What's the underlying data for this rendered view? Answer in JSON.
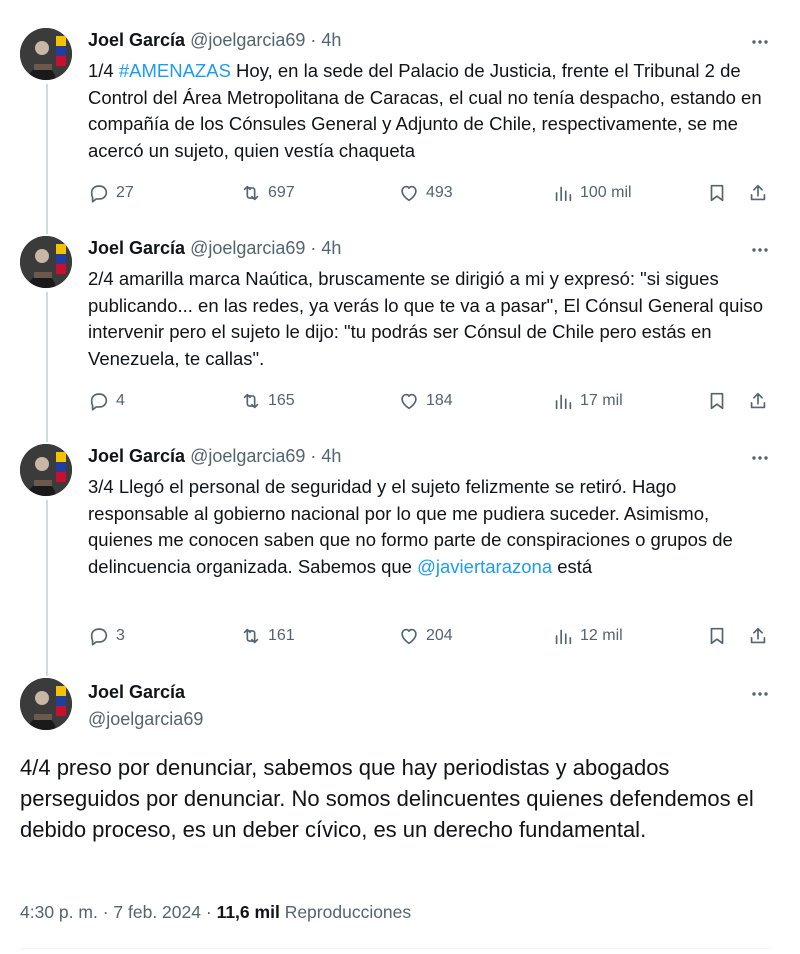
{
  "author": {
    "name": "Joel García",
    "handle": "@joelgarcia69"
  },
  "replies": [
    {
      "time": "4h",
      "number": "1/4",
      "hashtag": "#AMENAZAS",
      "text_after_hashtag": " Hoy, en la sede del Palacio de Justicia, frente el Tribunal 2 de Control del Área Metropolitana de Caracas, el cual no tenía despacho, estando en compañía de los Cónsules General y Adjunto de Chile, respectivamente, se me acercó un sujeto, quien vestía chaqueta",
      "stats": {
        "replies": "27",
        "reposts": "697",
        "likes": "493",
        "views": "100 mil"
      }
    },
    {
      "time": "4h",
      "text": "2/4 amarilla marca Naútica, bruscamente se dirigió a mi y expresó: \"si sigues publicando... en las redes, ya verás lo que te va a pasar\", El Cónsul General quiso intervenir pero el sujeto le dijo: \"tu podrás ser Cónsul de Chile pero estás en Venezuela, te callas\".",
      "stats": {
        "replies": "4",
        "reposts": "165",
        "likes": "184",
        "views": "17 mil"
      }
    },
    {
      "time": "4h",
      "text_before_mention": "3/4 Llegó el personal de seguridad y el sujeto felizmente se retiró. Hago responsable al gobierno nacional por lo que me pudiera suceder. Asimismo, quienes me conocen saben que no formo parte de conspiraciones o grupos de delincuencia organizada. Sabemos que ",
      "mention": "@javiertarazona",
      "text_after_mention": " está",
      "stats": {
        "replies": "3",
        "reposts": "161",
        "likes": "204",
        "views": "12 mil"
      }
    }
  ],
  "main_tweet": {
    "text": "4/4 preso por denunciar, sabemos que hay periodistas y abogados perseguidos por denunciar. No somos delincuentes quienes defendemos el debido proceso, es un deber cívico, es un derecho fundamental.",
    "time": "4:30 p. m.",
    "date": "7 feb. 2024",
    "views_count": "11,6 mil",
    "views_label": "Reproducciones"
  },
  "separator": "·",
  "icons": {
    "more": "more-dots-icon",
    "reply": "reply-bubble-icon",
    "repost": "repost-arrows-icon",
    "like": "heart-icon",
    "views": "views-bar-chart-icon",
    "bookmark": "bookmark-icon",
    "share": "share-upload-icon"
  },
  "colors": {
    "text": "#0f1419",
    "secondary": "#536471",
    "link": "#1d9bf0",
    "thread_line": "#cfd9de"
  }
}
